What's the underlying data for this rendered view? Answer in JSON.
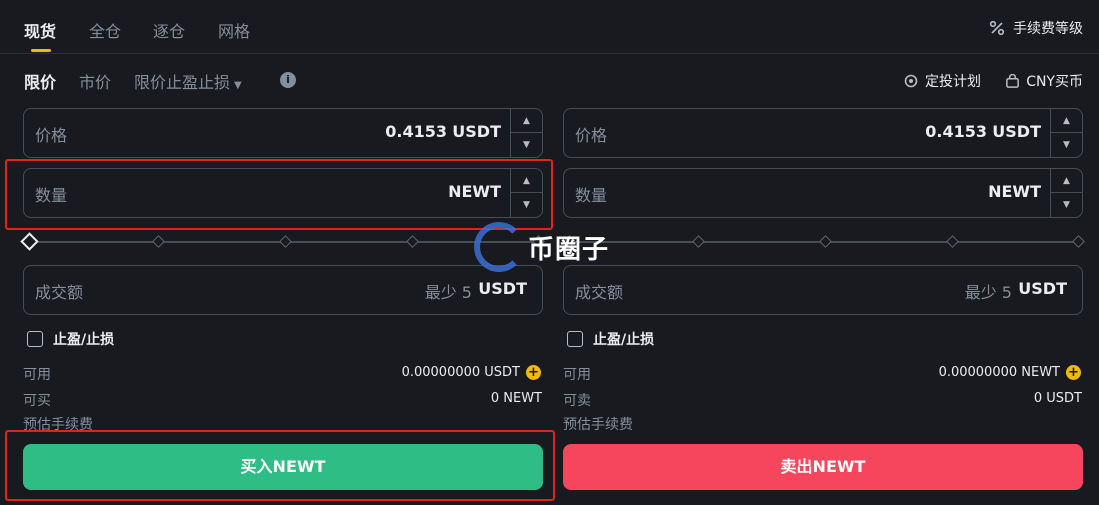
{
  "tabs": [
    {
      "label": "现货",
      "active": true
    },
    {
      "label": "全仓",
      "active": false
    },
    {
      "label": "逐仓",
      "active": false
    },
    {
      "label": "网格",
      "active": false
    }
  ],
  "fee_level": {
    "label": "手续费等级",
    "icon": "percent-icon"
  },
  "order_types": [
    {
      "label": "限价",
      "active": true
    },
    {
      "label": "市价",
      "active": false
    },
    {
      "label": "限价止盈止损",
      "active": false
    }
  ],
  "links": {
    "recurring": "定投计划",
    "cny": "CNY买币"
  },
  "buy": {
    "price_label": "价格",
    "price_value": "0.4153",
    "price_unit": "USDT",
    "amount_label": "数量",
    "amount_unit": "NEWT",
    "total_label": "成交额",
    "total_hint": "最少 5",
    "total_unit": "USDT",
    "tpsl_label": "止盈/止损",
    "avail_label": "可用",
    "avail_value": "0.00000000 USDT",
    "max_label": "可买",
    "max_value": "0 NEWT",
    "fee_label": "预估手续费",
    "button": "买入NEWT"
  },
  "sell": {
    "price_label": "价格",
    "price_value": "0.4153",
    "price_unit": "USDT",
    "amount_label": "数量",
    "amount_unit": "NEWT",
    "total_label": "成交额",
    "total_hint": "最少 5",
    "total_unit": "USDT",
    "tpsl_label": "止盈/止损",
    "avail_label": "可用",
    "avail_value": "0.00000000 NEWT",
    "max_label": "可卖",
    "max_value": "0 USDT",
    "fee_label": "预估手续费",
    "button": "卖出NEWT"
  },
  "watermark": "币圈子",
  "colors": {
    "buy": "#2ebd85",
    "sell": "#f6465d",
    "accent": "#f0b90b",
    "highlight": "#e0241b"
  }
}
